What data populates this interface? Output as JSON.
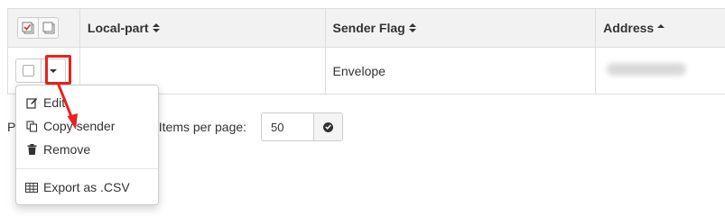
{
  "table": {
    "headers": {
      "local_part": "Local-part",
      "sender_flag": "Sender Flag",
      "address": "Address"
    },
    "sort": {
      "local_part": "both",
      "sender_flag": "both",
      "address": "ascending"
    },
    "rows": [
      {
        "local_part": "",
        "sender_flag": "Envelope",
        "address": "",
        "address_blurred": true,
        "checked": false
      }
    ]
  },
  "pagination": {
    "prefix": "P",
    "suffix": ". Items per page:",
    "items_per_page": "50"
  },
  "row_menu": {
    "open": true,
    "items": [
      {
        "label": "Edit",
        "icon": "edit-icon"
      },
      {
        "label": "Copy sender",
        "icon": "copy-icon"
      },
      {
        "label": "Remove",
        "icon": "trash-icon"
      }
    ],
    "export_item": {
      "label": "Export as .CSV",
      "icon": "table-icon"
    }
  },
  "annotation": {
    "highlight_color": "#e8231d",
    "target": "row-actions-dropdown-toggle"
  },
  "colors": {
    "header_bg": "#f2f2f2",
    "border": "#dddddd",
    "text": "#333333"
  }
}
